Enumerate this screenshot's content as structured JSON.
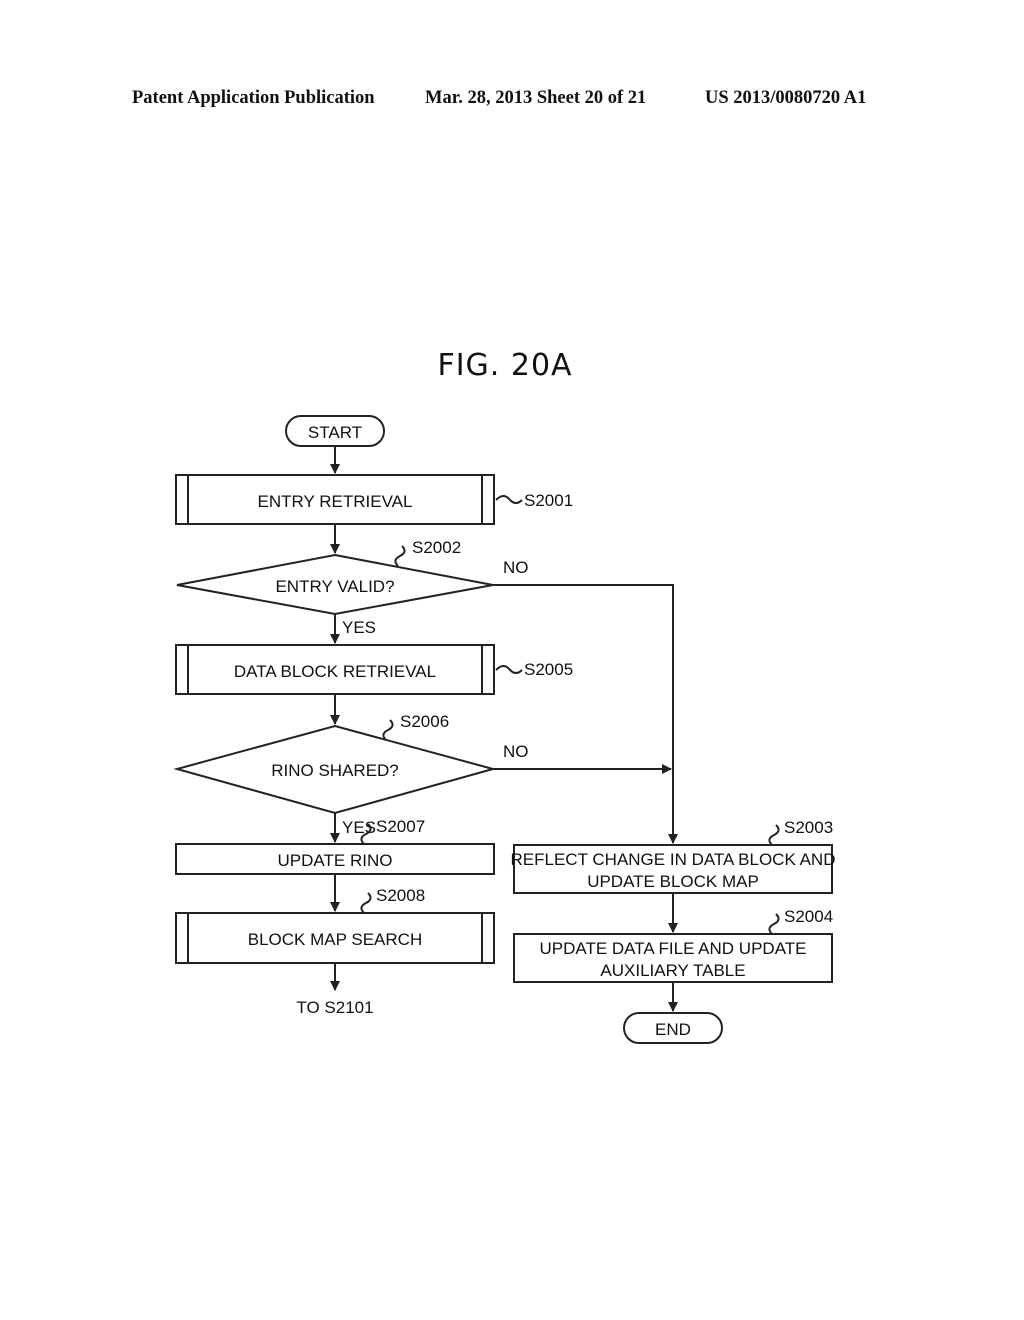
{
  "header": {
    "left": "Patent Application Publication",
    "middle": "Mar. 28, 2013  Sheet 20 of 21",
    "right": "US 2013/0080720 A1"
  },
  "figure": {
    "title": "FIG. 20A"
  },
  "flowchart": {
    "start": "START",
    "end": "END",
    "steps": {
      "s2001": {
        "id": "S2001",
        "label": "ENTRY RETRIEVAL",
        "type": "predefined-process"
      },
      "s2002": {
        "id": "S2002",
        "label": "ENTRY VALID?",
        "type": "decision",
        "yes": "YES",
        "no": "NO"
      },
      "s2005": {
        "id": "S2005",
        "label": "DATA BLOCK RETRIEVAL",
        "type": "predefined-process"
      },
      "s2006": {
        "id": "S2006",
        "label": "RINO SHARED?",
        "type": "decision",
        "yes": "YES",
        "no": "NO"
      },
      "s2007": {
        "id": "S2007",
        "label": "UPDATE RINO",
        "type": "process"
      },
      "s2008": {
        "id": "S2008",
        "label": "BLOCK MAP SEARCH",
        "type": "predefined-process"
      },
      "s2003": {
        "id": "S2003",
        "label_line1": "REFLECT CHANGE IN DATA BLOCK AND",
        "label_line2": "UPDATE BLOCK MAP",
        "type": "process"
      },
      "s2004": {
        "id": "S2004",
        "label_line1": "UPDATE DATA FILE AND UPDATE",
        "label_line2": "AUXILIARY TABLE",
        "type": "process"
      }
    },
    "connector": "TO S2101"
  }
}
